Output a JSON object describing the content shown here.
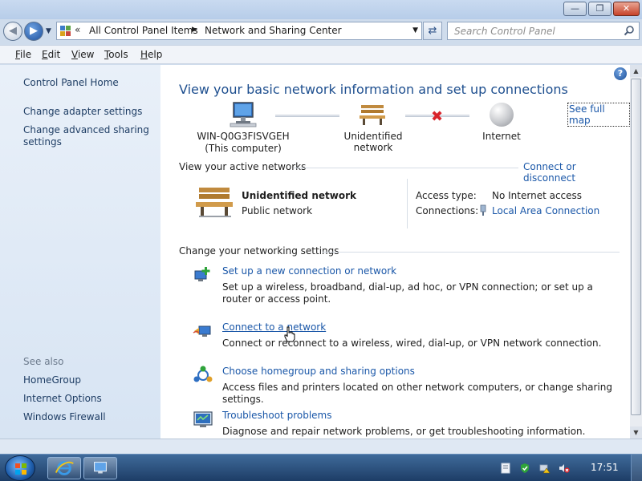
{
  "window": {
    "minimize_glyph": "—",
    "maximize_glyph": "❐",
    "close_glyph": "✕"
  },
  "nav": {
    "back_glyph": "◀",
    "forward_glyph": "▶",
    "history_glyph": "▼"
  },
  "address": {
    "overflow_glyph": "«",
    "crumbs": [
      "All Control Panel Items",
      "Network and Sharing Center"
    ],
    "separator_glyph": "▶",
    "dropdown_glyph": "▼",
    "refresh_glyph": "⇄"
  },
  "search": {
    "placeholder": "Search Control Panel"
  },
  "menu": {
    "items": [
      "File",
      "Edit",
      "View",
      "Tools",
      "Help"
    ]
  },
  "sidebar": {
    "home": "Control Panel Home",
    "adapter": "Change adapter settings",
    "advanced_sharing": "Change advanced sharing settings",
    "see_also": "See also",
    "homegroup": "HomeGroup",
    "internet_options": "Internet Options",
    "firewall": "Windows Firewall"
  },
  "main": {
    "help_glyph": "?",
    "title": "View your basic network information and set up connections",
    "see_full_map": "See full map",
    "map": {
      "computer_name": "WIN-Q0G3FISVGEH",
      "computer_sub": "(This computer)",
      "network": "Unidentified network",
      "internet": "Internet",
      "broken_glyph": "✖"
    },
    "active_header": "View your active networks",
    "connect_disconnect": "Connect or disconnect",
    "active_network": {
      "name": "Unidentified network",
      "type": "Public network",
      "access_label": "Access type:",
      "access_value": "No Internet access",
      "connections_label": "Connections:",
      "connections_value": "Local Area Connection"
    },
    "change_header": "Change your networking settings",
    "tasks": [
      {
        "link": "Set up a new connection or network",
        "desc": "Set up a wireless, broadband, dial-up, ad hoc, or VPN connection; or set up a router or access point."
      },
      {
        "link": "Connect to a network",
        "desc": "Connect or reconnect to a wireless, wired, dial-up, or VPN network connection."
      },
      {
        "link": "Choose homegroup and sharing options",
        "desc": "Access files and printers located on other network computers, or change sharing settings."
      },
      {
        "link": "Troubleshoot problems",
        "desc": "Diagnose and repair network problems, or get troubleshooting information."
      }
    ]
  },
  "scrollbar": {
    "up_glyph": "▲",
    "down_glyph": "▼"
  },
  "taskbar": {
    "clock": "17:51",
    "pinned": [
      "internet-explorer-icon",
      "control-panel-icon"
    ],
    "tray": [
      "action-center-icon",
      "network-warning-icon",
      "volume-muted-icon"
    ]
  },
  "colors": {
    "link": "#1a57a8",
    "title": "#1e4f8f",
    "error_x": "#d8232a"
  }
}
